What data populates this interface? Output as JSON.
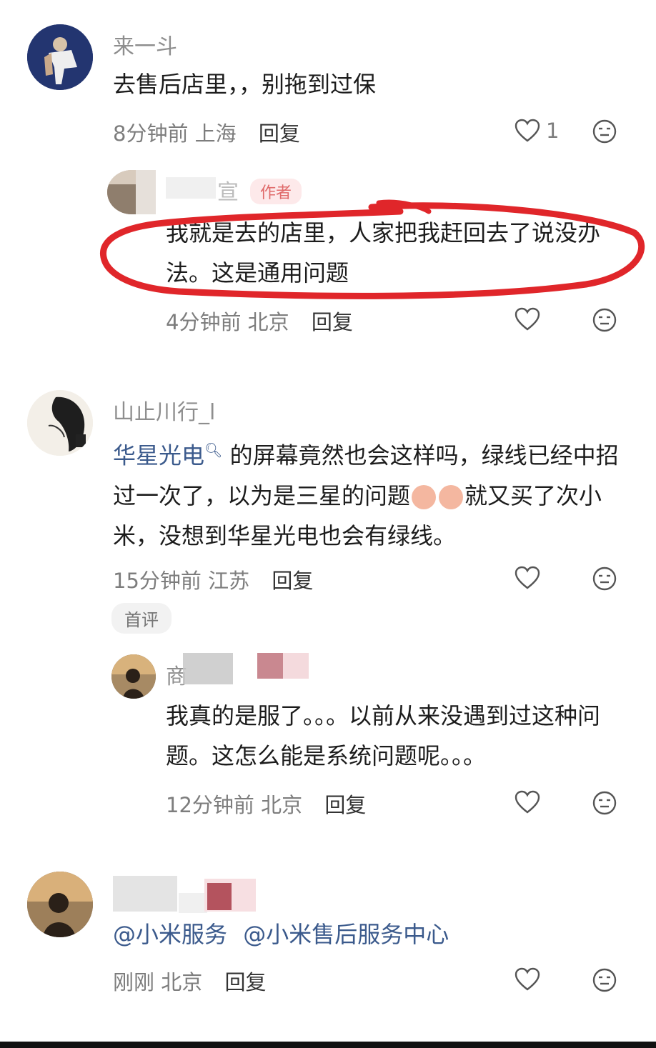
{
  "comments": [
    {
      "name": "来一斗",
      "text": "去售后店里，，别拖到过保",
      "time": "8分钟前",
      "location": "上海",
      "reply": "回复",
      "likes": "1",
      "replies": [
        {
          "name": "宣",
          "author_tag": "作者",
          "text": "我就是去的店里，人家把我赶回去了说没办法。这是通用问题",
          "time": "4分钟前",
          "location": "北京",
          "reply": "回复"
        }
      ]
    },
    {
      "name": "山止川行_l",
      "link_text": "华星光电",
      "link_icon": "search-icon",
      "text_after_link": "的屏幕竟然也会这样吗，绿线已经中招过一次了，以为是三星的问题",
      "text_tail": "就又买了次小米，没想到华星光电也会有绿线。",
      "time": "15分钟前",
      "location": "江苏",
      "reply": "回复",
      "badge": "首评",
      "replies": [
        {
          "name": "商",
          "text": "我真的是服了。。。以前从来没遇到过这种问题。这怎么能是系统问题呢。。。",
          "time": "12分钟前",
          "location": "北京",
          "reply": "回复"
        }
      ]
    },
    {
      "name": "",
      "mentions": [
        "@小米服务",
        "@小米售后服务中心"
      ],
      "time": "刚刚",
      "location": "北京",
      "reply": "回复"
    }
  ],
  "colors": {
    "annotation_circle": "#e0262a",
    "link": "#3b5a8c",
    "author_tag": "#e06a6a"
  }
}
